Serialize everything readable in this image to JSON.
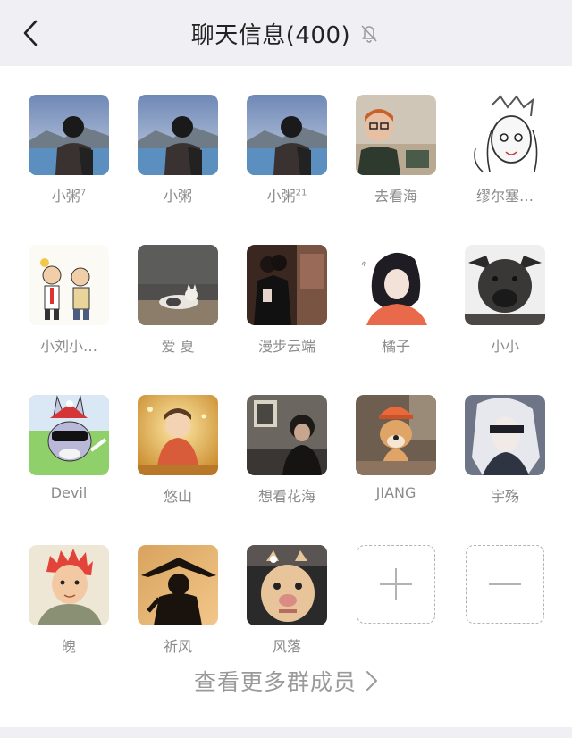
{
  "header": {
    "title": "聊天信息(400)",
    "back_icon": "chevron-left-icon",
    "mute_icon": "bell-off-icon"
  },
  "members": [
    {
      "name": "小粥",
      "sup": "7"
    },
    {
      "name": "小粥",
      "sup": ""
    },
    {
      "name": "小粥",
      "sup": "21"
    },
    {
      "name": "去看海",
      "sup": ""
    },
    {
      "name": "缪尔塞…",
      "sup": ""
    },
    {
      "name": "小刘小…",
      "sup": ""
    },
    {
      "name": "爱 夏",
      "sup": ""
    },
    {
      "name": "漫步云端",
      "sup": ""
    },
    {
      "name": "橘子",
      "sup": ""
    },
    {
      "name": "小小",
      "sup": ""
    },
    {
      "name": "Devil",
      "sup": ""
    },
    {
      "name": "悠山",
      "sup": ""
    },
    {
      "name": "想看花海",
      "sup": ""
    },
    {
      "name": "JIANG",
      "sup": ""
    },
    {
      "name": "宇殇",
      "sup": ""
    },
    {
      "name": "魄",
      "sup": ""
    },
    {
      "name": "祈风",
      "sup": ""
    },
    {
      "name": "风落",
      "sup": ""
    }
  ],
  "actions": {
    "add_icon": "plus-icon",
    "remove_icon": "minus-icon"
  },
  "footer": {
    "more_label": "查看更多群成员",
    "more_icon": "chevron-right-icon"
  },
  "colors": {
    "navbar_bg": "#efeff4",
    "name_text": "#8b8b8b",
    "dashed_border": "#b3b3b3"
  }
}
